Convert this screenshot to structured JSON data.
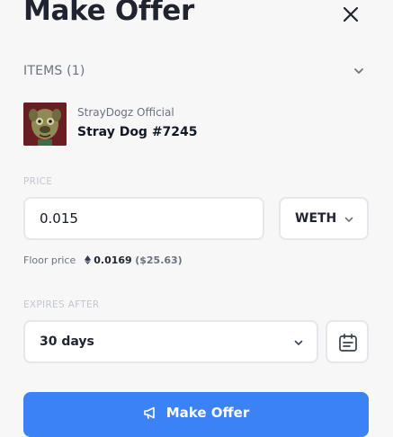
{
  "header": {
    "title": "Make Offer"
  },
  "items_section": {
    "label": "ITEMS (1)"
  },
  "item": {
    "collection": "StrayDogz Official",
    "name": "Stray Dog #7245"
  },
  "price": {
    "label": "PRICE",
    "value": "0.015",
    "currency": "WETH"
  },
  "floor": {
    "label": "Floor price",
    "value": "0.0169",
    "usd": "($25.63)"
  },
  "expires": {
    "label": "EXPIRES AFTER",
    "value": "30 days"
  },
  "cta": {
    "label": "Make Offer"
  },
  "colors": {
    "accent": "#3b82f6",
    "border": "#e5e7eb",
    "background": "#f7f7f8"
  }
}
